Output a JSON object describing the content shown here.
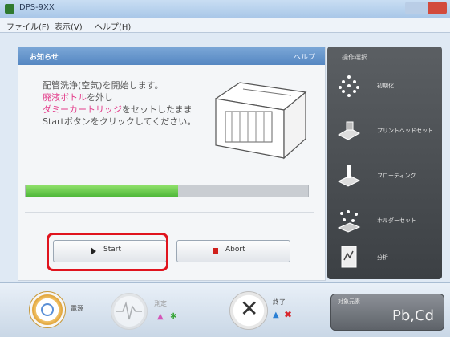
{
  "window": {
    "title": "DPS-9XX"
  },
  "menu": [
    "ファイル(F)",
    "表示(V)",
    "ヘルプ(H)"
  ],
  "panel": {
    "header_title": "お知らせ",
    "help": "ヘルプ",
    "message_lines": [
      {
        "parts": [
          {
            "text": "配管洗浄(空気)を開始します。",
            "highlight": false
          }
        ]
      },
      {
        "parts": [
          {
            "text": "廃液ボトル",
            "highlight": true
          },
          {
            "text": "を外し",
            "highlight": false
          }
        ]
      },
      {
        "parts": [
          {
            "text": "ダミーカートリッジ",
            "highlight": true
          },
          {
            "text": "をセットしたまま",
            "highlight": false
          }
        ]
      },
      {
        "parts": [
          {
            "text": "Startボタンをクリックしてください。",
            "highlight": false
          }
        ]
      }
    ],
    "progress": 0.54,
    "start_label": "Start",
    "abort_label": "Abort"
  },
  "right_panel": {
    "title": "操作選択",
    "items": [
      {
        "label": "初期化"
      },
      {
        "label": "プリントヘッドセット"
      },
      {
        "label": "フローティング"
      },
      {
        "label": "ホルダーセット"
      },
      {
        "label": "分析"
      }
    ]
  },
  "bottom": {
    "power_label": "電源",
    "measure_label": "測定",
    "exit_label": "終了",
    "device_subtitle": "対象元素",
    "device_value": "Pb,Cd"
  },
  "colors": {
    "highlight": "#e33c8a",
    "accent_red": "#e0141e",
    "progress_green": "#4fb83a"
  }
}
